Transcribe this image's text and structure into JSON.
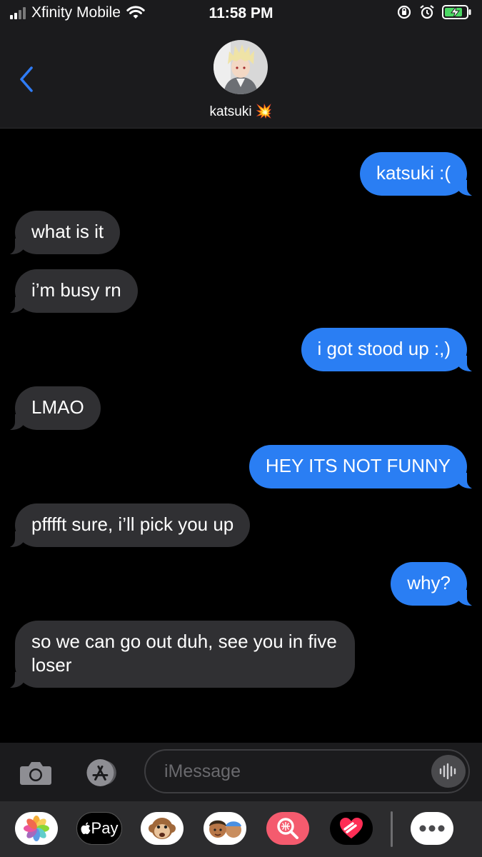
{
  "status_bar": {
    "carrier": "Xfinity Mobile",
    "time": "11:58 PM"
  },
  "header": {
    "contact_name": "katsuki 💥"
  },
  "messages": [
    {
      "side": "out",
      "text": "katsuki :("
    },
    {
      "side": "in",
      "text": "what is it"
    },
    {
      "side": "in",
      "text": "i’m busy rn"
    },
    {
      "side": "out",
      "text": "i got stood up :,)"
    },
    {
      "side": "in",
      "text": "LMAO"
    },
    {
      "side": "out",
      "text": "HEY ITS NOT FUNNY"
    },
    {
      "side": "in",
      "text": "pfffft sure, i’ll pick you up"
    },
    {
      "side": "out",
      "text": "why?"
    },
    {
      "side": "in",
      "text": "so we can go out duh, see you in five loser"
    }
  ],
  "input": {
    "placeholder": "iMessage"
  },
  "app_drawer": {
    "apple_pay_label": "Pay",
    "apps": [
      "photos-icon",
      "apple-pay-icon",
      "animoji-icon",
      "memoji-icon",
      "images-search-icon",
      "digital-touch-icon",
      "more-icon"
    ]
  },
  "colors": {
    "outgoing_bubble": "#2a7ef3",
    "incoming_bubble": "#303033",
    "accent": "#2f7cf6"
  }
}
